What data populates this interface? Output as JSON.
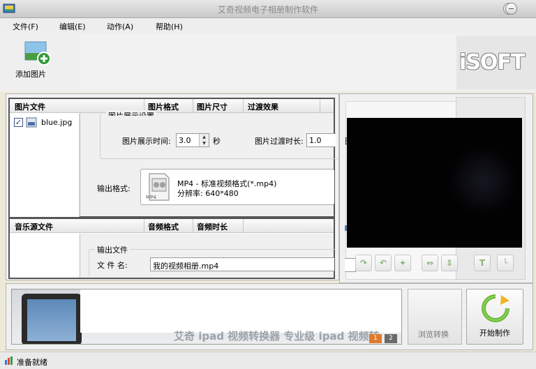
{
  "window": {
    "title": "艾奇视频电子相册制作软件",
    "minimize_symbol": "−",
    "restore_symbol": "□",
    "close_symbol": "✕"
  },
  "menubar": {
    "items": [
      "文件(F)",
      "编辑(E)",
      "动作(A)",
      "帮助(H)"
    ]
  },
  "toolbar": {
    "add_picture_label": "添加图片",
    "logo_text": "iSOFT"
  },
  "picture_list": {
    "columns": [
      "图片文件",
      "图片格式",
      "图片尺寸",
      "过渡效果"
    ],
    "rows": [
      {
        "checked": true,
        "check_mark": "✓",
        "file_name": "blue.jpg"
      }
    ]
  },
  "music_list": {
    "columns": [
      "音乐源文件",
      "音频格式",
      "音频时长"
    ]
  },
  "settings": {
    "group_title": "图片展示设置",
    "display_time_label": "图片展示时间:",
    "display_time_value": "3.0",
    "display_time_unit": "秒",
    "transition_time_label": "图片过渡时长:",
    "transition_time_value": "1.0",
    "output_format_label": "输出格式:",
    "format_name": "MP4 - 标准视频格式(*.mp4)",
    "format_resolution": "分辨率: 640*480",
    "format_icon_text": "MP4",
    "output_file_group_title": "输出文件",
    "file_name_label": "文 件 名:",
    "file_name_value": "我的视频相册.mp4",
    "cut_char": "图"
  },
  "preview": {
    "buttons": [
      {
        "name": "rotate-right-icon",
        "glyph": "↷"
      },
      {
        "name": "rotate-left-icon",
        "glyph": "↶"
      },
      {
        "name": "effects-icon",
        "glyph": "✦"
      },
      {
        "name": "flip-horizontal-icon",
        "glyph": "⇔"
      },
      {
        "name": "flip-vertical-icon",
        "glyph": "⇕"
      },
      {
        "name": "text-icon",
        "glyph": "T"
      },
      {
        "name": "crop-icon",
        "glyph": "└"
      }
    ]
  },
  "bottom": {
    "ad_text": "艾奇 ipad 视频转换器 专业级 ipad 视频转",
    "pages": [
      "1",
      "2"
    ],
    "middle_button_label": "浏览转换",
    "start_button_label": "开始制作"
  },
  "statusbar": {
    "text": "准备就绪"
  }
}
